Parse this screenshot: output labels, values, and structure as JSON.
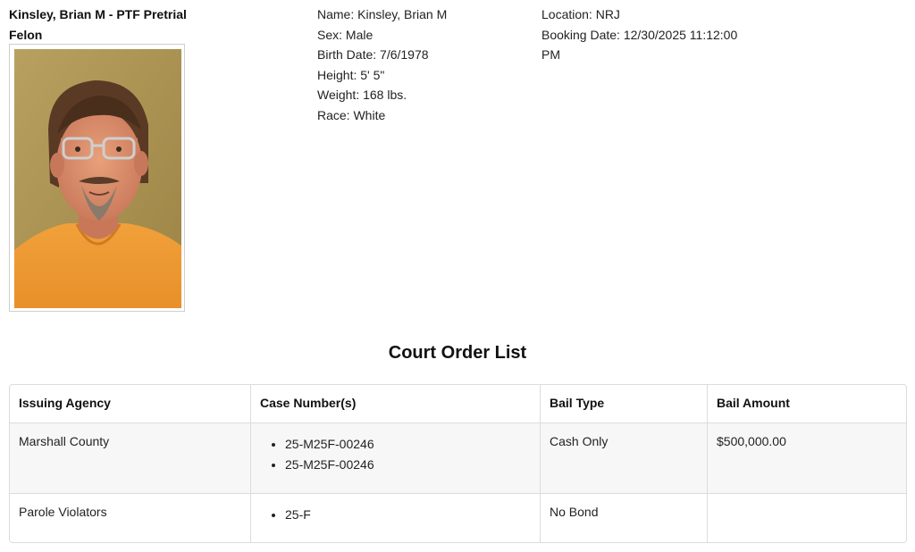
{
  "inmate": {
    "title_line1": "Kinsley, Brian M - PTF Pretrial",
    "title_line2": "Felon",
    "photo_alt": "Booking photo"
  },
  "details": {
    "name": "Name: Kinsley, Brian M",
    "sex": "Sex: Male",
    "birth_date": "Birth Date: 7/6/1978",
    "height": "Height: 5' 5\"",
    "weight": "Weight: 168 lbs.",
    "race": "Race: White"
  },
  "booking": {
    "location": "Location: NRJ",
    "booking_date": "Booking Date: 12/30/2025 11:12:00 PM"
  },
  "court_orders": {
    "title": "Court Order List",
    "headers": [
      "Issuing Agency",
      "Case Number(s)",
      "Bail Type",
      "Bail Amount"
    ],
    "rows": [
      {
        "agency": "Marshall County",
        "cases": [
          "25-M25F-00246",
          "25-M25F-00246"
        ],
        "bail_type": "Cash Only",
        "bail_amount": "$500,000.00"
      },
      {
        "agency": "Parole Violators",
        "cases": [
          "25-F"
        ],
        "bail_type": "No Bond",
        "bail_amount": ""
      }
    ]
  }
}
